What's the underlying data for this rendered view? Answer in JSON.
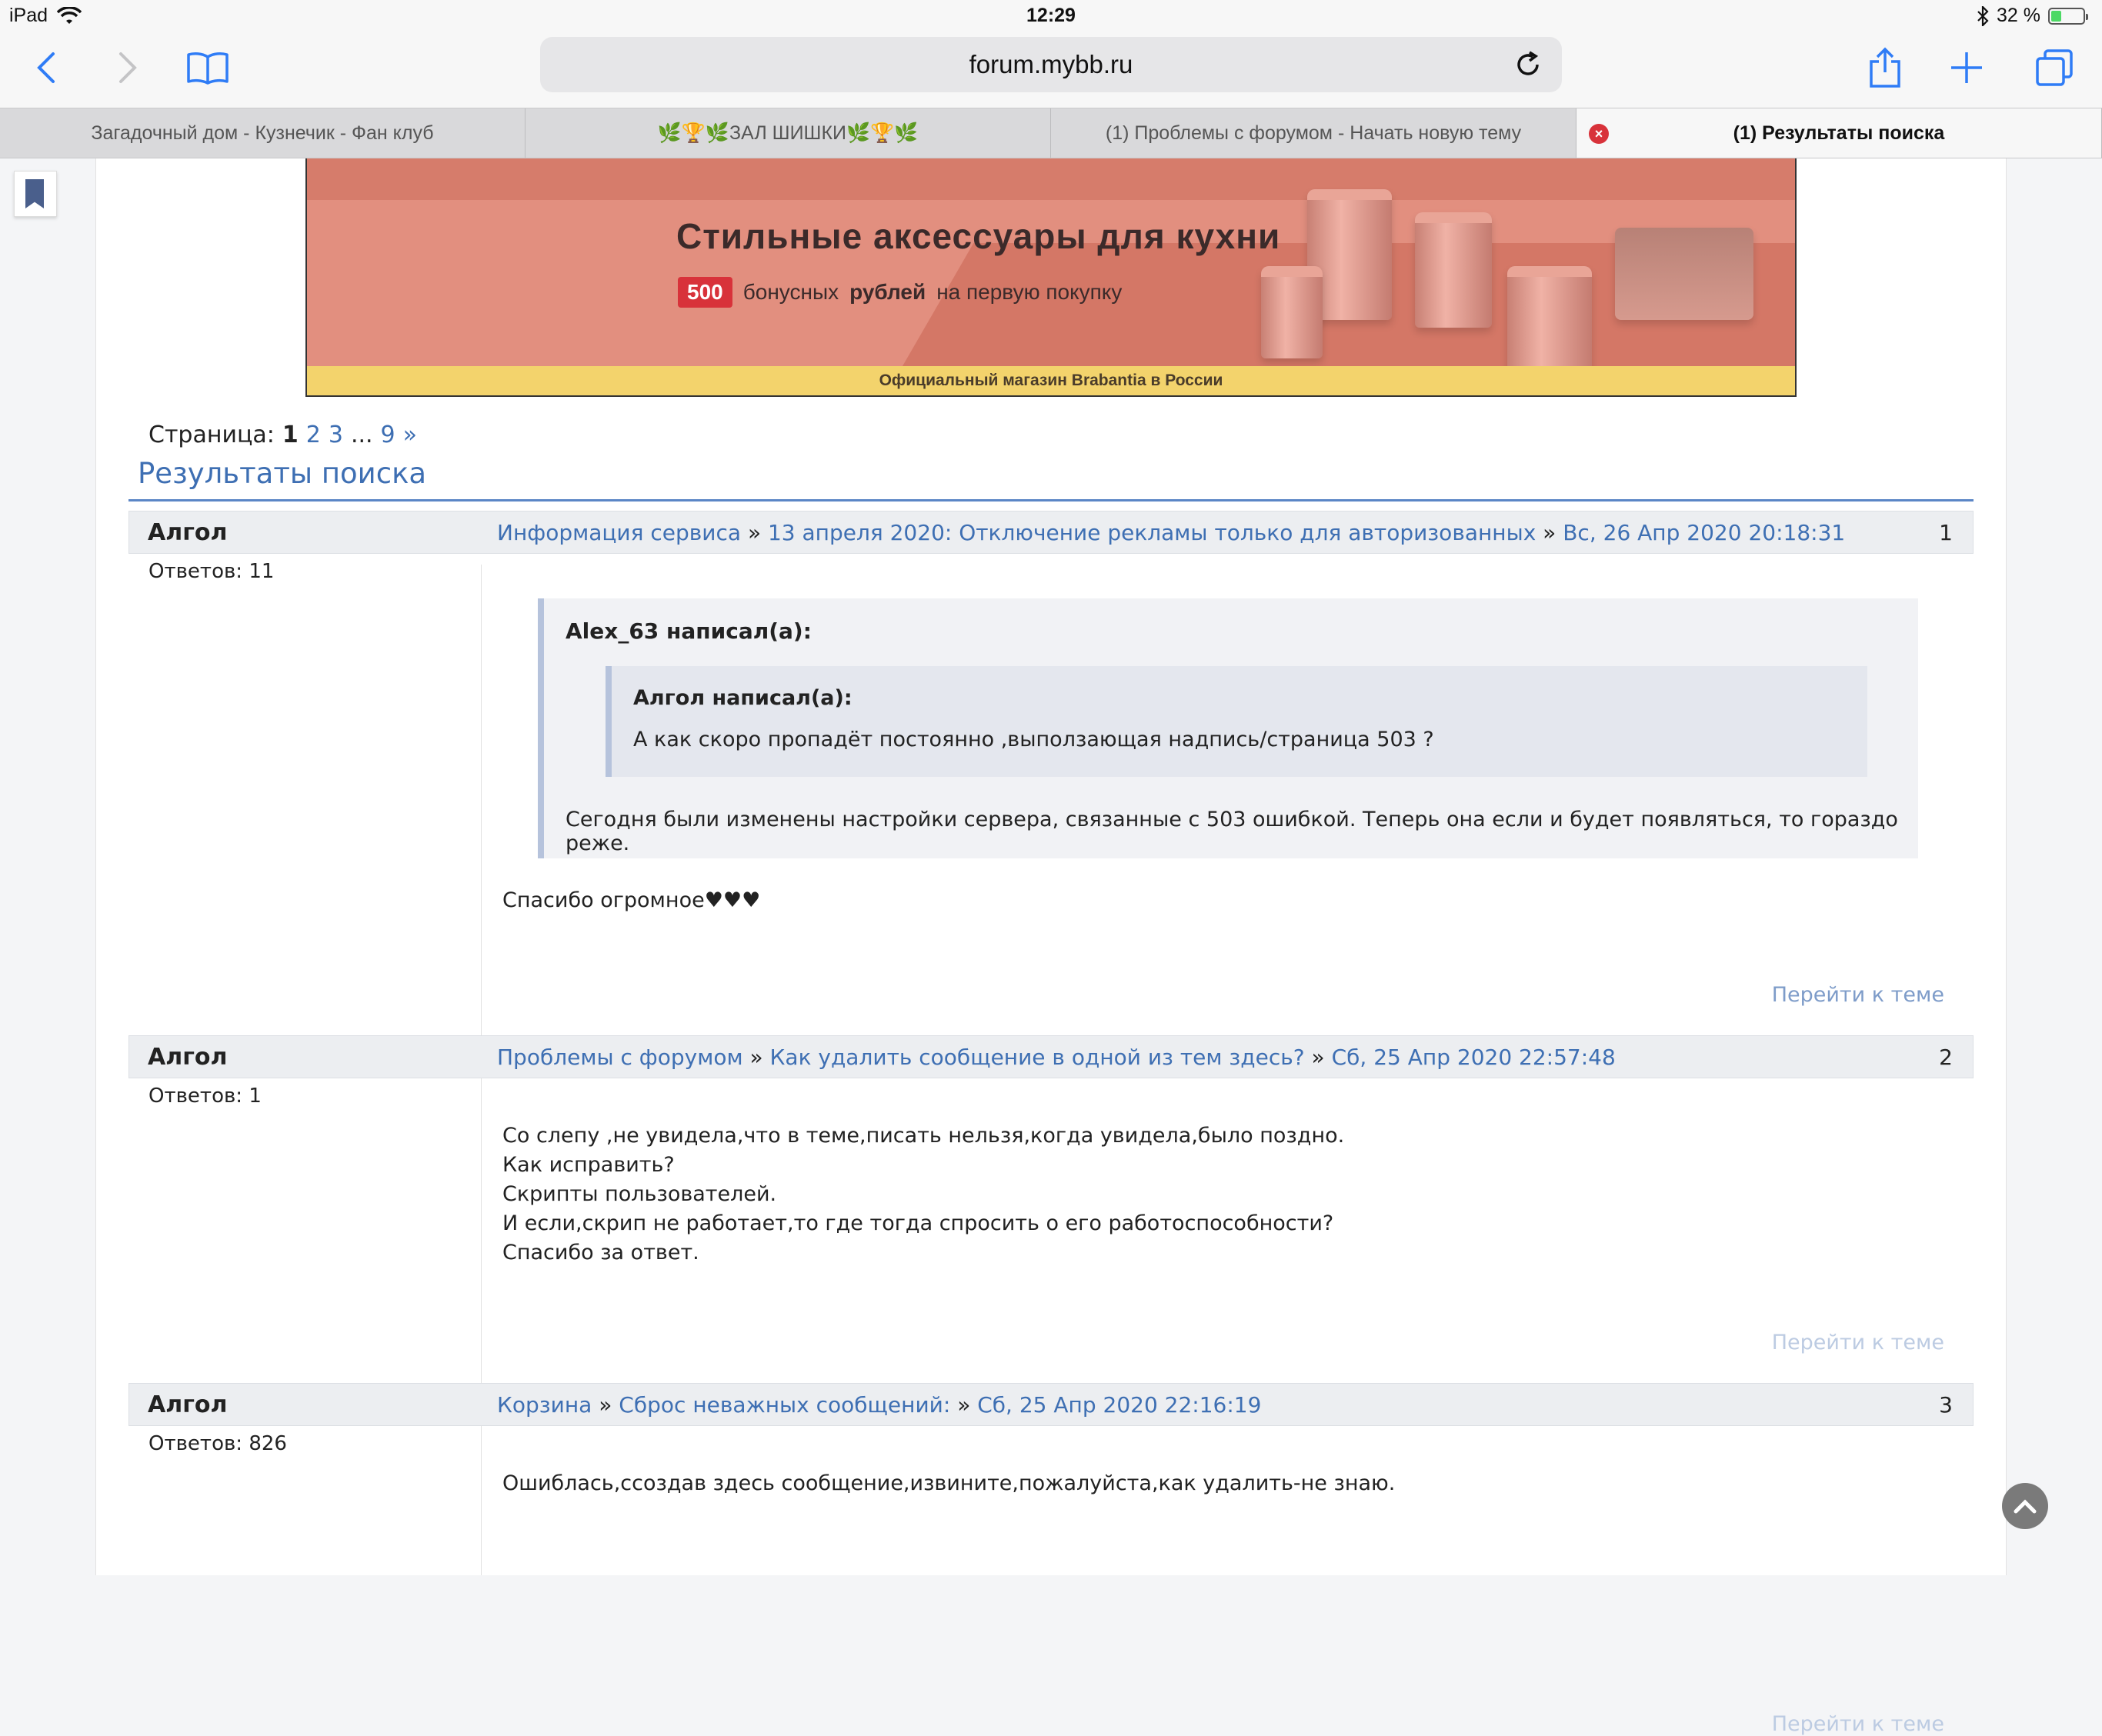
{
  "status": {
    "device": "iPad",
    "time": "12:29",
    "battery": "32 %",
    "battery_level": 0.32
  },
  "browser": {
    "url": "forum.mybb.ru",
    "tabs": [
      {
        "label": "Загадочный дом - Кузнечик - Фан клуб",
        "active": false
      },
      {
        "label": "🌿🏆🌿ЗАЛ ШИШКИ🌿🏆🌿",
        "active": false
      },
      {
        "label": "(1) Проблемы с форумом - Начать новую тему",
        "active": false
      },
      {
        "label": "(1) Результаты поиска",
        "active": true
      }
    ],
    "close_glyph": "×"
  },
  "ad": {
    "title": "Стильные аксессуары для кухни",
    "badge": "500",
    "sub_pre": "бонусных",
    "sub_bold": "рублей",
    "sub_post": "на первую покупку",
    "footer": "Официальный магазин Brabantia в России"
  },
  "pagination": {
    "label": "Страница:",
    "current": "1",
    "p2": "2",
    "p3": "3",
    "ellipsis": "...",
    "last": "9",
    "next": "»"
  },
  "heading": "Результаты поиска",
  "posts": [
    {
      "author": "Алгол",
      "crumb1": "Информация сервиса",
      "crumb2": "13 апреля 2020: Отключение рекламы только для авторизованных",
      "date": "Вс, 26 Апр 2020 20:18:31",
      "sep": "»",
      "num": "1",
      "replies": "Ответов: 11",
      "quote_author": "Alex_63 написал(а):",
      "inner_quote_author": "Алгол написал(а):",
      "inner_quote_text": "А как скоро пропадёт постоянно ,выползающая надпись/страница  503 ?",
      "quote_text": "Сегодня были изменены настройки сервера, связанные с 503 ошибкой. Теперь она если и будет появляться, то гораздо реже.",
      "text": "Спасибо огромное♥♥♥",
      "goto": "Перейти к теме"
    },
    {
      "author": "Алгол",
      "crumb1": "Проблемы с форумом",
      "crumb2": "Как удалить сообщение в одной из тем здесь?",
      "date": "Сб, 25 Апр 2020 22:57:48",
      "sep": "»",
      "num": "2",
      "replies": "Ответов: 1",
      "lines": [
        "Со слепу ,не увидела,что в теме,писать нельзя,когда увидела,было поздно.",
        "Как исправить?",
        "Скрипты пользователей.",
        "И если,скрип не работает,то где тогда спросить о его работоспособности?",
        "Спасибо за ответ."
      ],
      "goto": "Перейти к теме"
    },
    {
      "author": "Алгол",
      "crumb1": "Корзина",
      "crumb2": "Сброс неважных сообщений:",
      "date": "Сб, 25 Апр 2020 22:16:19",
      "sep": "»",
      "num": "3",
      "replies": "Ответов: 826",
      "text": "Ошиблась,ссоздав здесь сообщение,извините,пожалуйста,как удалить-не знаю.",
      "goto": "Перейти к теме"
    }
  ],
  "icons": {
    "back": "chevron-left-icon",
    "forward": "chevron-right-icon",
    "bookmarks": "book-icon",
    "reload": "reload-icon",
    "share": "share-icon",
    "new_tab": "plus-icon",
    "tabs_overview": "tabs-icon",
    "wifi": "wifi-icon",
    "bluetooth": "bluetooth-icon",
    "scroll_top": "arrow-up-icon"
  },
  "colors": {
    "accent": "#3e6fb3",
    "tab_close": "#d8323a",
    "ad_bg": "#e28f7f",
    "ad_footer": "#f3d36c"
  }
}
